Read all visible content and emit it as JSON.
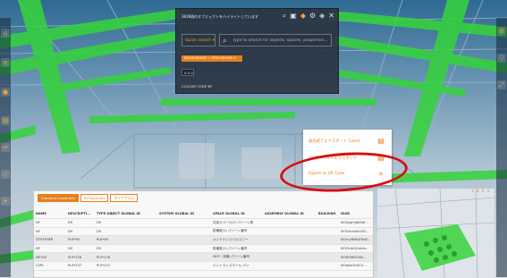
{
  "search_panel": {
    "title": "3836個のオブジェクトをハイライトしています",
    "quick_search_label": "Quick search",
    "search_placeholder": "Type to search for objects, spaces, properties...",
    "filter_chip": "BEAMSBEAMS = STEELBEAMS",
    "value": "0.0.0",
    "colour_code_label": "COLOUR CODE BY",
    "toolbar_icons": [
      "search-icon",
      "filter-icon",
      "paint-icon",
      "settings-icon",
      "tag-icon",
      "close-icon"
    ]
  },
  "properties": {
    "tabs": [
      "Common properties",
      "IfcProperties",
      "ダイアグラム"
    ],
    "columns": [
      "NAME",
      "DESCRIPTI...",
      "TYPE OBJECT GLOBAL ID",
      "SYSTEM GLOBAL ID",
      "SPACE GLOBAL ID",
      "ASSEMBLY GLOBAL ID",
      "BUILDING",
      "GUID"
    ],
    "rows": [
      [
        "NF",
        "D9",
        "D9",
        "",
        "共用スペース(2) パソーン表",
        "",
        "",
        "0lO0gwYg6Ze8..."
      ],
      [
        "NF",
        "D9",
        "D9",
        "",
        "設備室(1) パソーン番号 ",
        "",
        "",
        "0lO0AcIshhOS8..."
      ],
      [
        "STIFFENER",
        "PL6*96",
        "PL6*96",
        "",
        "メンテナンスバルコニー ",
        "",
        "",
        "0lOmyNBtQFBeE..."
      ],
      [
        "NF",
        "D9",
        "D9",
        "",
        "設備室(1) パソーン番号 ",
        "",
        "",
        "0lOFmbQGak4v..."
      ],
      [
        "METAX",
        "PL9*128",
        "PL9*128",
        "",
        "MDF・設備 パソーン番号",
        "",
        "",
        "0lOBYt6D2Wk..."
      ],
      [
        "CVPL",
        "PL9*237",
        "PL9*237",
        "",
        "エントランスホール パソ",
        "",
        "",
        "0lOqbe1hKrCt..."
      ]
    ]
  },
  "context_menu": {
    "items": [
      {
        "label": "表形式でエクスポート Colect",
        "icon": "document-icon"
      },
      {
        "label": "csvファイルへエクスポート",
        "icon": "document-icon"
      },
      {
        "label": "Export as QR Code",
        "icon": "qr-code-icon"
      }
    ]
  },
  "mini_view_pager": "3 4 5 >",
  "colors": {
    "accent": "#e77f1d",
    "highlight_green": "#35d43a",
    "annotation_red": "#d60f14",
    "panel_dark": "#28303c"
  },
  "left_toolbar_icons": [
    "home-icon",
    "layers-icon",
    "palette-icon",
    "document-icon",
    "measure-icon",
    "section-icon",
    "light-icon"
  ],
  "right_toolbar_icons": [
    "settings-icon",
    "filter-icon",
    "expand-icon"
  ]
}
